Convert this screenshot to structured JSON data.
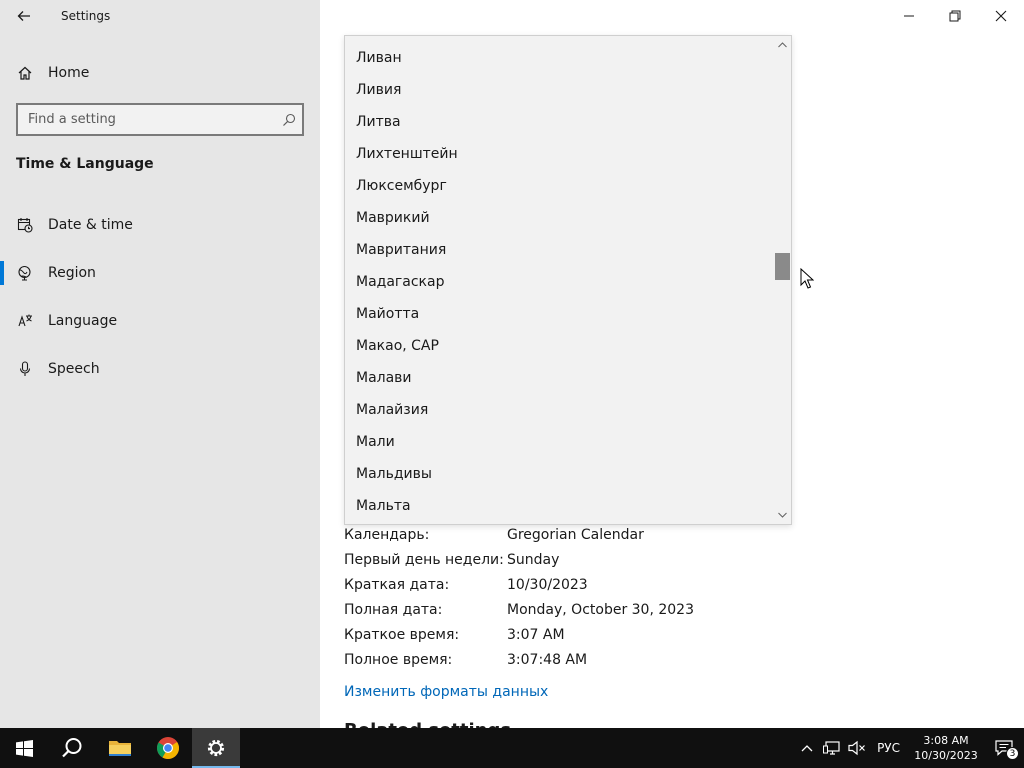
{
  "window": {
    "title": "Settings"
  },
  "sidebar": {
    "home_label": "Home",
    "search_placeholder": "Find a setting",
    "section_title": "Time & Language",
    "items": [
      {
        "label": "Date & time",
        "icon": "date-time-icon"
      },
      {
        "label": "Region",
        "icon": "region-globe-icon",
        "active": true
      },
      {
        "label": "Language",
        "icon": "language-icon"
      },
      {
        "label": "Speech",
        "icon": "microphone-icon"
      }
    ]
  },
  "dropdown": {
    "items": [
      "Ливан",
      "Ливия",
      "Литва",
      "Лихтенштейн",
      "Люксембург",
      "Маврикий",
      "Мавритания",
      "Мадагаскар",
      "Майотта",
      "Макао, САР",
      "Малави",
      "Малайзия",
      "Мали",
      "Мальдивы",
      "Мальта"
    ]
  },
  "formats": {
    "rows": [
      {
        "label": "Календарь:",
        "value": "Gregorian Calendar"
      },
      {
        "label": "Первый день недели:",
        "value": "Sunday"
      },
      {
        "label": "Краткая дата:",
        "value": "10/30/2023"
      },
      {
        "label": "Полная дата:",
        "value": "Monday, October 30, 2023"
      },
      {
        "label": "Краткое время:",
        "value": "3:07 AM"
      },
      {
        "label": "Полное время:",
        "value": "3:07:48 AM"
      }
    ],
    "change_link": "Изменить форматы данных",
    "related_title": "Related settings"
  },
  "taskbar": {
    "language": "РУС",
    "time": "3:08 AM",
    "date": "10/30/2023",
    "notification_count": "3"
  },
  "colors": {
    "accent": "#0078d7",
    "link": "#0067b8",
    "sidebar_bg": "#e6e6e6",
    "taskbar_bg": "#101010"
  }
}
